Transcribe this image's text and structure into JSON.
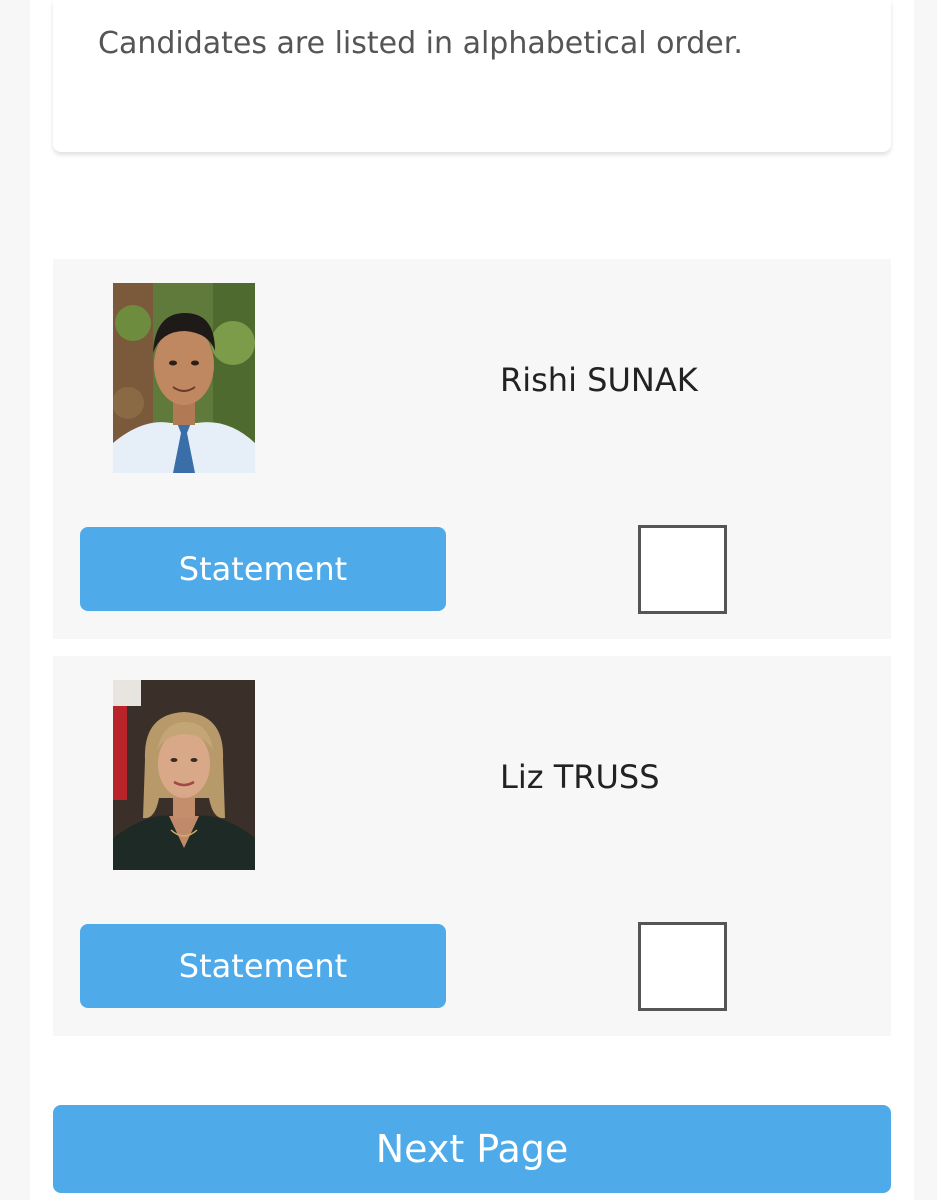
{
  "intro": {
    "text": "Candidates are listed in alphabetical order."
  },
  "candidates": [
    {
      "name": "Rishi SUNAK",
      "statement_label": "Statement",
      "photo_icon": "candidate-photo-rishi-sunak",
      "checked": false
    },
    {
      "name": "Liz TRUSS",
      "statement_label": "Statement",
      "photo_icon": "candidate-photo-liz-truss",
      "checked": false
    }
  ],
  "footer": {
    "next_label": "Next Page"
  },
  "colors": {
    "accent": "#4eaae8",
    "card_bg": "#f7f7f7",
    "text": "#222222",
    "muted_text": "#555555"
  }
}
